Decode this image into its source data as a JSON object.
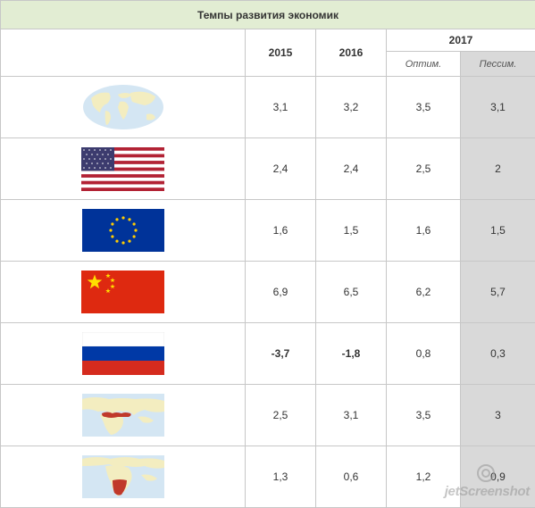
{
  "table": {
    "title": "Темпы развития экономик",
    "years": {
      "y2015": "2015",
      "y2016": "2016",
      "y2017": "2017"
    },
    "scenarios": {
      "optimistic": "Оптим.",
      "pessimistic": "Пессим."
    },
    "rows": [
      {
        "flag": "world-map-icon",
        "y2015": "3,1",
        "y2016": "3,2",
        "opt": "3,5",
        "pess": "3,1"
      },
      {
        "flag": "usa-flag-icon",
        "y2015": "2,4",
        "y2016": "2,4",
        "opt": "2,5",
        "pess": "2"
      },
      {
        "flag": "eu-flag-icon",
        "y2015": "1,6",
        "y2016": "1,5",
        "opt": "1,6",
        "pess": "1,5"
      },
      {
        "flag": "china-flag-icon",
        "y2015": "6,9",
        "y2016": "6,5",
        "opt": "6,2",
        "pess": "5,7"
      },
      {
        "flag": "russia-flag-icon",
        "y2015": "-3,7",
        "y2016": "-1,8",
        "opt": "0,8",
        "pess": "0,3"
      },
      {
        "flag": "mena-region-map-icon",
        "y2015": "2,5",
        "y2016": "3,1",
        "opt": "3,5",
        "pess": "3"
      },
      {
        "flag": "sub-saharan-africa-map-icon",
        "y2015": "1,3",
        "y2016": "0,6",
        "opt": "1,2",
        "pess": "0,9"
      }
    ]
  },
  "colors": {
    "header_bg": "#e2edd3",
    "pessimistic_bg": "#d9d9d9",
    "negative": "#c00000",
    "border": "#c7c7c7"
  },
  "watermark": {
    "text": "jetScreenshot"
  }
}
